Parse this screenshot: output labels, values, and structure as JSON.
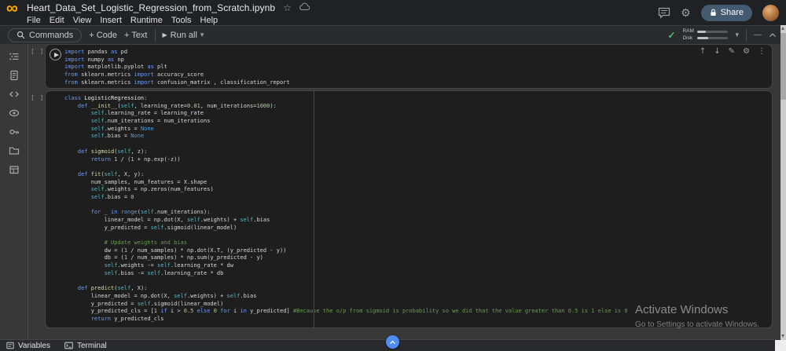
{
  "header": {
    "filename": "Heart_Data_Set_Logistic_Regression_from_Scratch.ipynb",
    "menu_items": [
      "File",
      "Edit",
      "View",
      "Insert",
      "Runtime",
      "Tools",
      "Help"
    ],
    "share_label": "Share"
  },
  "toolbar": {
    "commands_label": "Commands",
    "add_code_label": "+ Code",
    "add_text_label": "+ Text",
    "run_all_label": "Run all",
    "ram_label": "RAM",
    "disk_label": "Disk"
  },
  "icons": {
    "infinity": "∞",
    "star": "☆",
    "gear": "⚙",
    "check": "✓",
    "play": "▶",
    "caret_down": "▾",
    "dash": "—",
    "arrow_up": "↑",
    "arrow_down": "↓",
    "pencil": "✎",
    "cell_gear": "⚙",
    "more_vert": "⋮"
  },
  "colors": {
    "accent_blue": "#4d8cf5",
    "logo_orange": "#f9ab00",
    "status_green": "#5bb974",
    "cell_bg": "#1e1e1e",
    "page_bg": "#383838",
    "keyword": "#6c9bfa",
    "function": "#dcdcaa",
    "self": "#56b6c2",
    "number": "#b5cea8",
    "constant": "#569cd6",
    "comment": "#6a9955"
  },
  "cells": [
    {
      "exec_label": "[ ]",
      "lines": [
        [
          [
            "k",
            "import"
          ],
          [
            "t",
            " pandas "
          ],
          [
            "k",
            "as"
          ],
          [
            "t",
            " pd"
          ]
        ],
        [
          [
            "k",
            "import"
          ],
          [
            "t",
            " numpy "
          ],
          [
            "k",
            "as"
          ],
          [
            "t",
            " np"
          ]
        ],
        [
          [
            "k",
            "import"
          ],
          [
            "t",
            " matplotlib.pyplot "
          ],
          [
            "k",
            "as"
          ],
          [
            "t",
            " plt"
          ]
        ],
        [
          [
            "k",
            "from"
          ],
          [
            "t",
            " sklearn.metrics "
          ],
          [
            "k",
            "import"
          ],
          [
            "t",
            " accuracy_score"
          ]
        ],
        [
          [
            "k",
            "from"
          ],
          [
            "t",
            " sklearn.metrics "
          ],
          [
            "k",
            "import"
          ],
          [
            "t",
            " confusion_matrix , classification_report"
          ]
        ]
      ]
    },
    {
      "exec_label": "[ ]",
      "lines": [
        [
          [
            "k",
            "class"
          ],
          [
            "cl",
            " LogisticRegression"
          ],
          [
            "t",
            ":"
          ]
        ],
        [
          [
            "t",
            "    "
          ],
          [
            "k",
            "def"
          ],
          [
            "f",
            " __init__"
          ],
          [
            "t",
            "("
          ],
          [
            "s",
            "self"
          ],
          [
            "t",
            ", learning_rate="
          ],
          [
            "n",
            "0.01"
          ],
          [
            "t",
            ", num_iterations="
          ],
          [
            "n",
            "1000"
          ],
          [
            "t",
            "):"
          ]
        ],
        [
          [
            "t",
            "        "
          ],
          [
            "s",
            "self"
          ],
          [
            "t",
            ".learning_rate = learning_rate"
          ]
        ],
        [
          [
            "t",
            "        "
          ],
          [
            "s",
            "self"
          ],
          [
            "t",
            ".num_iterations = num_iterations"
          ]
        ],
        [
          [
            "t",
            "        "
          ],
          [
            "s",
            "self"
          ],
          [
            "t",
            ".weights = "
          ],
          [
            "b",
            "None"
          ]
        ],
        [
          [
            "t",
            "        "
          ],
          [
            "s",
            "self"
          ],
          [
            "t",
            ".bias = "
          ],
          [
            "b",
            "None"
          ]
        ],
        [],
        [
          [
            "t",
            "    "
          ],
          [
            "k",
            "def"
          ],
          [
            "f",
            " sigmoid"
          ],
          [
            "t",
            "("
          ],
          [
            "s",
            "self"
          ],
          [
            "t",
            ", z):"
          ]
        ],
        [
          [
            "t",
            "        "
          ],
          [
            "k",
            "return"
          ],
          [
            "t",
            " "
          ],
          [
            "n",
            "1"
          ],
          [
            "t",
            " / ("
          ],
          [
            "n",
            "1"
          ],
          [
            "t",
            " + np.exp(-z))"
          ]
        ],
        [],
        [
          [
            "t",
            "    "
          ],
          [
            "k",
            "def"
          ],
          [
            "f",
            " fit"
          ],
          [
            "t",
            "("
          ],
          [
            "s",
            "self"
          ],
          [
            "t",
            ", X, y):"
          ]
        ],
        [
          [
            "t",
            "        num_samples, num_features = X.shape"
          ]
        ],
        [
          [
            "t",
            "        "
          ],
          [
            "s",
            "self"
          ],
          [
            "t",
            ".weights = np.zeros(num_features)"
          ]
        ],
        [
          [
            "t",
            "        "
          ],
          [
            "s",
            "self"
          ],
          [
            "t",
            ".bias = "
          ],
          [
            "n",
            "0"
          ]
        ],
        [],
        [
          [
            "t",
            "        "
          ],
          [
            "k",
            "for"
          ],
          [
            "t",
            " _ "
          ],
          [
            "k",
            "in"
          ],
          [
            "t",
            " "
          ],
          [
            "b",
            "range"
          ],
          [
            "t",
            "("
          ],
          [
            "s",
            "self"
          ],
          [
            "t",
            ".num_iterations):"
          ]
        ],
        [
          [
            "t",
            "            linear_model = np.dot(X, "
          ],
          [
            "s",
            "self"
          ],
          [
            "t",
            ".weights) + "
          ],
          [
            "s",
            "self"
          ],
          [
            "t",
            ".bias"
          ]
        ],
        [
          [
            "t",
            "            y_predicted = "
          ],
          [
            "s",
            "self"
          ],
          [
            "t",
            ".sigmoid(linear_model)"
          ]
        ],
        [],
        [
          [
            "t",
            "            "
          ],
          [
            "c",
            "# Update weights and bias"
          ]
        ],
        [
          [
            "t",
            "            dw = ("
          ],
          [
            "n",
            "1"
          ],
          [
            "t",
            " / num_samples) * np.dot(X.T, (y_predicted - y))"
          ]
        ],
        [
          [
            "t",
            "            db = ("
          ],
          [
            "n",
            "1"
          ],
          [
            "t",
            " / num_samples) * np.sum(y_predicted - y)"
          ]
        ],
        [
          [
            "t",
            "            "
          ],
          [
            "s",
            "self"
          ],
          [
            "t",
            ".weights -= "
          ],
          [
            "s",
            "self"
          ],
          [
            "t",
            ".learning_rate * dw"
          ]
        ],
        [
          [
            "t",
            "            "
          ],
          [
            "s",
            "self"
          ],
          [
            "t",
            ".bias -= "
          ],
          [
            "s",
            "self"
          ],
          [
            "t",
            ".learning_rate * db"
          ]
        ],
        [],
        [
          [
            "t",
            "    "
          ],
          [
            "k",
            "def"
          ],
          [
            "f",
            " predict"
          ],
          [
            "t",
            "("
          ],
          [
            "s",
            "self"
          ],
          [
            "t",
            ", X):"
          ]
        ],
        [
          [
            "t",
            "        linear_model = np.dot(X, "
          ],
          [
            "s",
            "self"
          ],
          [
            "t",
            ".weights) + "
          ],
          [
            "s",
            "self"
          ],
          [
            "t",
            ".bias"
          ]
        ],
        [
          [
            "t",
            "        y_predicted = "
          ],
          [
            "s",
            "self"
          ],
          [
            "t",
            ".sigmoid(linear_model)"
          ]
        ],
        [
          [
            "t",
            "        y_predicted_cls = ["
          ],
          [
            "n",
            "1"
          ],
          [
            "t",
            " "
          ],
          [
            "k",
            "if"
          ],
          [
            "t",
            " i > "
          ],
          [
            "n",
            "0.5"
          ],
          [
            "t",
            " "
          ],
          [
            "k",
            "else"
          ],
          [
            "t",
            " "
          ],
          [
            "n",
            "0"
          ],
          [
            "t",
            " "
          ],
          [
            "k",
            "for"
          ],
          [
            "t",
            " i "
          ],
          [
            "k",
            "in"
          ],
          [
            "t",
            " y_predicted] "
          ],
          [
            "c",
            "#Because the o/p from sigmoid is probability so we did that the value greater than 0.5 is 1 else is 0"
          ]
        ],
        [
          [
            "t",
            "        "
          ],
          [
            "k",
            "return"
          ],
          [
            "t",
            " y_predicted_cls"
          ]
        ]
      ]
    }
  ],
  "bottom_bar": {
    "variables_label": "Variables",
    "terminal_label": "Terminal"
  },
  "watermark": {
    "line1": "Activate Windows",
    "line2": "Go to Settings to activate Windows."
  }
}
